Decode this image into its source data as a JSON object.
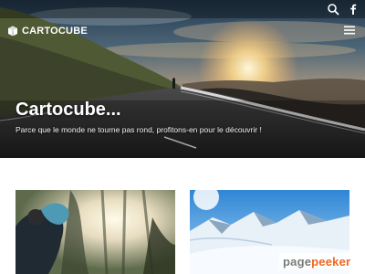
{
  "header": {
    "brand": "CARTOCUBE",
    "icons": [
      "search-icon",
      "facebook-icon",
      "hamburger-menu-icon"
    ]
  },
  "hero": {
    "title": "Cartocube...",
    "subtitle": "Parce que le monde ne tourne pas rond, profitons-en pour le découvrir !"
  },
  "posts": [
    {
      "image": "runner-in-forest"
    },
    {
      "image": "snowy-mountains"
    }
  ],
  "watermark": {
    "prefix": "page",
    "suffix": "peeker"
  },
  "colors": {
    "hero_overlay": "#1b1b1c",
    "text": "#ffffff",
    "watermark_accent": "#f26522",
    "watermark_gray": "#7a7a7a"
  }
}
